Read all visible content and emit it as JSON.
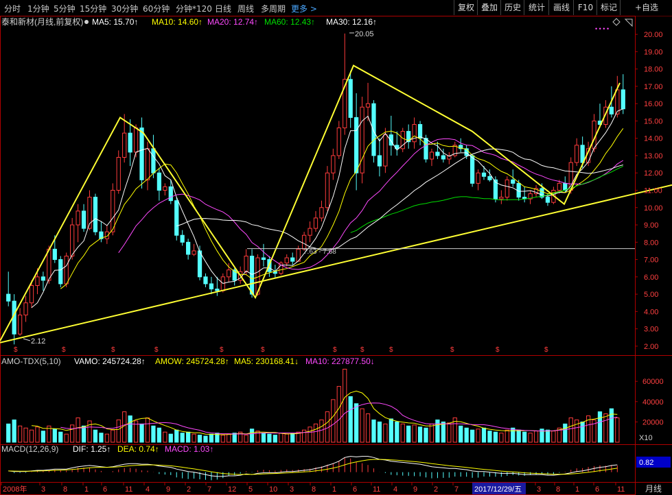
{
  "toolbar": {
    "periods": [
      "分时",
      "1分钟",
      "5分钟",
      "15分钟",
      "30分钟",
      "60分钟",
      "分钟*120",
      "日线",
      "周线",
      "多周期"
    ],
    "more": "更多 >",
    "right_buttons": [
      "复权",
      "叠加",
      "历史",
      "统计",
      "画线",
      "F10",
      "标记",
      "+自选"
    ]
  },
  "main_header": {
    "title": "泰和新材(月线,前复权)",
    "ma5": "MA5: 15.70↑",
    "ma10": "MA10: 14.60↑",
    "ma20": "MA20: 12.74↑",
    "ma60": "MA60: 12.43↑",
    "ma30": "MA30: 12.16↑"
  },
  "vol_header": {
    "name": "AMO-TDX(5,10)",
    "vamo": "VAMO: 245724.28↑",
    "amow": "AMOW: 245724.28↑",
    "ma5": "MA5: 230168.41↓",
    "ma10": "MA10: 227877.50↓"
  },
  "macd_header": {
    "name": "MACD(12,26,9)",
    "dif": "DIF: 1.25↑",
    "dea": "DEA: 0.74↑",
    "macd": "MACD: 1.03↑"
  },
  "annotations": {
    "high": "20.05",
    "low": "2.12",
    "level_label": "7.63 - 7.68"
  },
  "bottom_axis": {
    "labels": [
      "2008年",
      "3",
      "8",
      "1",
      "6",
      "11",
      "4",
      "9",
      "2",
      "7",
      "12",
      "5",
      "10",
      "3",
      "8",
      "1",
      "6",
      "11",
      "4",
      "9",
      "2",
      "7",
      "12",
      "5",
      "10",
      "3",
      "8",
      "1",
      "6",
      "11"
    ],
    "cursor_date": "2017/12/29/五",
    "period": "月线"
  },
  "vol_axis": {
    "unit_label": "X10"
  },
  "macd_axis": {
    "value_box": "0.82"
  },
  "colors": {
    "up": "#ff3c3c",
    "down": "#54ffff",
    "ma5": "#ffffff",
    "ma10": "#ffff00",
    "ma20": "#ff4aff",
    "ma60": "#00e000",
    "ma30": "#ffffff",
    "trendline": "#ffff33",
    "axis": "#b00000",
    "label": "#ff4040"
  },
  "chart_data": [
    {
      "type": "candlestick",
      "title": "泰和新材(月线,前复权)",
      "ylim": [
        1.6,
        20.4
      ],
      "y_ticks": [
        2,
        3,
        4,
        5,
        6,
        7,
        8,
        9,
        10,
        11,
        12,
        13,
        14,
        15,
        16,
        17,
        18,
        19,
        20
      ],
      "grid": false,
      "series_high_label": 20.05,
      "series_low_label": 2.12,
      "level": [
        7.63,
        7.68
      ],
      "ohlc": [
        [
          5.0,
          6.3,
          4.3,
          4.6
        ],
        [
          4.6,
          5.0,
          2.1,
          2.7
        ],
        [
          2.7,
          4.2,
          2.6,
          3.8
        ],
        [
          3.8,
          4.9,
          3.4,
          4.5
        ],
        [
          4.5,
          5.8,
          4.2,
          5.5
        ],
        [
          5.5,
          6.5,
          5.0,
          6.0
        ],
        [
          6.0,
          6.3,
          5.2,
          5.8
        ],
        [
          5.8,
          7.8,
          5.6,
          7.6
        ],
        [
          7.6,
          8.4,
          6.8,
          7.0
        ],
        [
          7.0,
          7.2,
          5.4,
          5.6
        ],
        [
          5.6,
          7.4,
          5.4,
          7.2
        ],
        [
          7.2,
          9.4,
          7.0,
          9.0
        ],
        [
          9.0,
          10.2,
          8.0,
          9.8
        ],
        [
          9.8,
          10.2,
          8.6,
          8.8
        ],
        [
          8.8,
          11.0,
          8.7,
          10.6
        ],
        [
          10.6,
          10.8,
          8.4,
          8.6
        ],
        [
          8.6,
          9.2,
          8.0,
          8.2
        ],
        [
          8.2,
          9.0,
          7.9,
          8.6
        ],
        [
          8.6,
          11.4,
          8.4,
          11.0
        ],
        [
          11.0,
          13.3,
          10.8,
          12.9
        ],
        [
          12.9,
          15.4,
          12.6,
          14.3
        ],
        [
          14.3,
          15.1,
          12.4,
          13.2
        ],
        [
          13.2,
          14.8,
          12.9,
          14.6
        ],
        [
          14.6,
          15.2,
          11.1,
          11.6
        ],
        [
          11.6,
          13.8,
          11.0,
          13.4
        ],
        [
          13.4,
          14.2,
          11.7,
          12.0
        ],
        [
          12.0,
          12.3,
          10.4,
          11.0
        ],
        [
          11.0,
          11.4,
          10.7,
          11.2
        ],
        [
          11.2,
          11.6,
          10.2,
          10.4
        ],
        [
          10.4,
          10.6,
          8.1,
          8.4
        ],
        [
          8.4,
          8.7,
          7.8,
          8.0
        ],
        [
          8.0,
          8.2,
          7.0,
          7.3
        ],
        [
          7.3,
          7.9,
          7.2,
          7.5
        ],
        [
          7.5,
          7.8,
          5.8,
          6.0
        ],
        [
          6.0,
          6.2,
          5.4,
          5.6
        ],
        [
          5.6,
          6.0,
          5.0,
          5.3
        ],
        [
          5.3,
          6.0,
          4.9,
          5.2
        ],
        [
          5.2,
          6.2,
          5.1,
          6.0
        ],
        [
          6.0,
          6.8,
          5.7,
          6.4
        ],
        [
          6.4,
          6.5,
          5.5,
          5.8
        ],
        [
          5.8,
          6.6,
          5.6,
          6.3
        ],
        [
          6.3,
          7.6,
          6.1,
          7.2
        ],
        [
          7.2,
          7.6,
          4.8,
          5.0
        ],
        [
          5.0,
          7.3,
          4.9,
          7.1
        ],
        [
          7.1,
          7.9,
          6.6,
          7.0
        ],
        [
          7.0,
          7.2,
          6.0,
          6.3
        ],
        [
          6.3,
          6.7,
          5.9,
          6.2
        ],
        [
          6.2,
          6.9,
          6.1,
          6.8
        ],
        [
          6.8,
          7.3,
          6.6,
          7.1
        ],
        [
          7.1,
          7.4,
          6.7,
          6.9
        ],
        [
          6.9,
          7.8,
          6.9,
          7.6
        ],
        [
          7.6,
          8.6,
          7.5,
          8.4
        ],
        [
          8.4,
          9.2,
          8.0,
          8.8
        ],
        [
          8.8,
          9.8,
          8.6,
          9.4
        ],
        [
          9.4,
          10.4,
          9.2,
          10.0
        ],
        [
          10.0,
          12.4,
          9.8,
          12.0
        ],
        [
          12.0,
          13.4,
          11.6,
          13.0
        ],
        [
          13.0,
          15.0,
          12.8,
          14.6
        ],
        [
          14.6,
          20.05,
          14.2,
          17.4
        ],
        [
          17.4,
          17.9,
          14.6,
          15.2
        ],
        [
          15.2,
          16.6,
          11.0,
          12.0
        ],
        [
          12.0,
          16.4,
          11.4,
          15.8
        ],
        [
          15.8,
          17.2,
          15.0,
          16.0
        ],
        [
          16.0,
          16.2,
          12.6,
          13.0
        ],
        [
          13.0,
          14.0,
          11.8,
          12.4
        ],
        [
          12.4,
          14.6,
          12.0,
          14.2
        ],
        [
          14.2,
          15.3,
          13.0,
          13.6
        ],
        [
          13.6,
          14.4,
          13.0,
          13.4
        ],
        [
          13.4,
          14.6,
          13.2,
          14.4
        ],
        [
          14.4,
          14.8,
          13.4,
          13.8
        ],
        [
          13.8,
          15.2,
          13.4,
          14.8
        ],
        [
          14.8,
          15.0,
          13.6,
          14.0
        ],
        [
          14.0,
          14.2,
          12.6,
          12.8
        ],
        [
          12.8,
          13.4,
          12.4,
          13.2
        ],
        [
          13.2,
          13.8,
          12.8,
          13.0
        ],
        [
          13.0,
          13.4,
          12.6,
          12.8
        ],
        [
          12.8,
          13.2,
          12.5,
          13.0
        ],
        [
          13.0,
          13.8,
          12.9,
          13.6
        ],
        [
          13.6,
          14.0,
          13.2,
          13.4
        ],
        [
          13.4,
          13.6,
          12.8,
          13.0
        ],
        [
          13.0,
          13.1,
          11.2,
          11.4
        ],
        [
          11.4,
          12.2,
          11.0,
          12.0
        ],
        [
          12.0,
          12.4,
          11.6,
          11.8
        ],
        [
          11.8,
          12.2,
          11.5,
          11.6
        ],
        [
          11.6,
          11.8,
          10.3,
          10.5
        ],
        [
          10.5,
          11.0,
          10.2,
          10.6
        ],
        [
          10.6,
          11.8,
          10.4,
          11.6
        ],
        [
          11.6,
          12.2,
          11.2,
          11.4
        ],
        [
          11.4,
          11.6,
          10.4,
          10.6
        ],
        [
          10.6,
          11.2,
          10.3,
          10.5
        ],
        [
          10.5,
          11.0,
          10.2,
          10.8
        ],
        [
          10.8,
          11.3,
          10.6,
          11.1
        ],
        [
          11.1,
          11.4,
          10.5,
          10.6
        ],
        [
          10.6,
          10.8,
          10.1,
          10.3
        ],
        [
          10.3,
          11.2,
          10.2,
          11.0
        ],
        [
          11.0,
          11.6,
          10.8,
          11.4
        ],
        [
          11.4,
          11.8,
          10.9,
          11.0
        ],
        [
          11.0,
          12.9,
          10.8,
          12.6
        ],
        [
          12.6,
          14.0,
          12.4,
          13.6
        ],
        [
          13.6,
          14.1,
          12.3,
          12.6
        ],
        [
          12.6,
          13.8,
          12.4,
          13.4
        ],
        [
          13.4,
          15.4,
          13.2,
          15.0
        ],
        [
          15.0,
          16.0,
          14.6,
          14.8
        ],
        [
          14.8,
          16.2,
          14.6,
          15.8
        ],
        [
          15.8,
          17.0,
          15.2,
          15.4
        ],
        [
          15.4,
          17.6,
          15.2,
          16.8
        ],
        [
          16.8,
          17.7,
          15.4,
          15.7
        ]
      ],
      "ma": [
        {
          "name": "MA5",
          "color": "ma5",
          "period": 5
        },
        {
          "name": "MA10",
          "color": "ma10",
          "period": 10
        },
        {
          "name": "MA20",
          "color": "ma20",
          "period": 20
        },
        {
          "name": "MA60",
          "color": "ma60",
          "period": 60
        },
        {
          "name": "MA30",
          "color": "ma30",
          "period": 30
        }
      ],
      "trendlines": [
        [
          [
            0.0,
            2.3
          ],
          [
            175.0,
            15.2
          ],
          [
            209.0,
            14.3
          ],
          [
            372.0,
            4.8
          ],
          [
            515.0,
            18.2
          ],
          [
            688.0,
            14.4
          ],
          [
            822.0,
            10.2
          ],
          [
            903.0,
            17.2
          ]
        ],
        [
          [
            0.0,
            2.2
          ],
          [
            979.0,
            11.3
          ]
        ]
      ]
    },
    {
      "type": "bar",
      "title": "AMO-TDX(5,10)",
      "ylim": [
        0,
        75000
      ],
      "y_ticks": [
        20000,
        40000,
        60000
      ],
      "values": [
        18000,
        22000,
        16000,
        14000,
        12000,
        15000,
        11000,
        16000,
        13000,
        10000,
        8000,
        17000,
        24000,
        16000,
        21000,
        12000,
        9000,
        8000,
        12000,
        22000,
        30000,
        26000,
        21000,
        18000,
        24000,
        16000,
        14000,
        10000,
        8000,
        12000,
        9000,
        10000,
        8000,
        7000,
        6000,
        8000,
        9000,
        7000,
        8000,
        9000,
        10000,
        7000,
        13000,
        11000,
        9000,
        8000,
        7000,
        9000,
        8000,
        9000,
        10000,
        12000,
        15000,
        18000,
        22000,
        30000,
        42000,
        55000,
        72000,
        45000,
        38000,
        33000,
        28000,
        22000,
        20000,
        18000,
        23000,
        20000,
        18000,
        16000,
        17000,
        15000,
        14000,
        18000,
        22000,
        20000,
        19000,
        24000,
        16000,
        14000,
        12000,
        13000,
        14000,
        11000,
        10000,
        9000,
        12000,
        14000,
        12000,
        10000,
        9000,
        11000,
        13000,
        12000,
        11000,
        14000,
        18000,
        24000,
        22000,
        20000,
        26000,
        22000,
        30000,
        28000,
        33000,
        24000
      ],
      "ma": [
        "MA5",
        "MA10"
      ]
    },
    {
      "type": "bar",
      "title": "MACD(12,26,9)",
      "y_value_box": 0.82,
      "dif": [
        0.2,
        0.1,
        0.1,
        0.1,
        0.2,
        0.3,
        0.3,
        0.4,
        0.5,
        0.5,
        0.5,
        0.7,
        0.9,
        1.0,
        1.1,
        1.0,
        0.9,
        0.8,
        0.9,
        1.1,
        1.3,
        1.4,
        1.4,
        1.3,
        1.3,
        1.2,
        1.0,
        0.9,
        0.8,
        0.5,
        0.3,
        0.1,
        0.0,
        -0.2,
        -0.4,
        -0.6,
        -0.7,
        -0.7,
        -0.6,
        -0.6,
        -0.5,
        -0.3,
        -0.4,
        -0.2,
        -0.1,
        -0.1,
        -0.1,
        0.0,
        0.1,
        0.1,
        0.2,
        0.3,
        0.4,
        0.6,
        0.8,
        1.1,
        1.4,
        1.8,
        2.4,
        2.6,
        2.5,
        2.6,
        2.6,
        2.4,
        2.1,
        2.0,
        1.8,
        1.7,
        1.6,
        1.5,
        1.4,
        1.3,
        1.1,
        0.9,
        0.8,
        0.7,
        0.6,
        0.6,
        0.5,
        0.4,
        0.2,
        0.1,
        0.1,
        0.0,
        -0.1,
        -0.2,
        -0.2,
        -0.2,
        -0.3,
        -0.4,
        -0.4,
        -0.4,
        -0.4,
        -0.5,
        -0.5,
        -0.4,
        -0.3,
        -0.1,
        0.1,
        0.2,
        0.4,
        0.6,
        0.8,
        0.9,
        1.1,
        1.2
      ]
    }
  ]
}
